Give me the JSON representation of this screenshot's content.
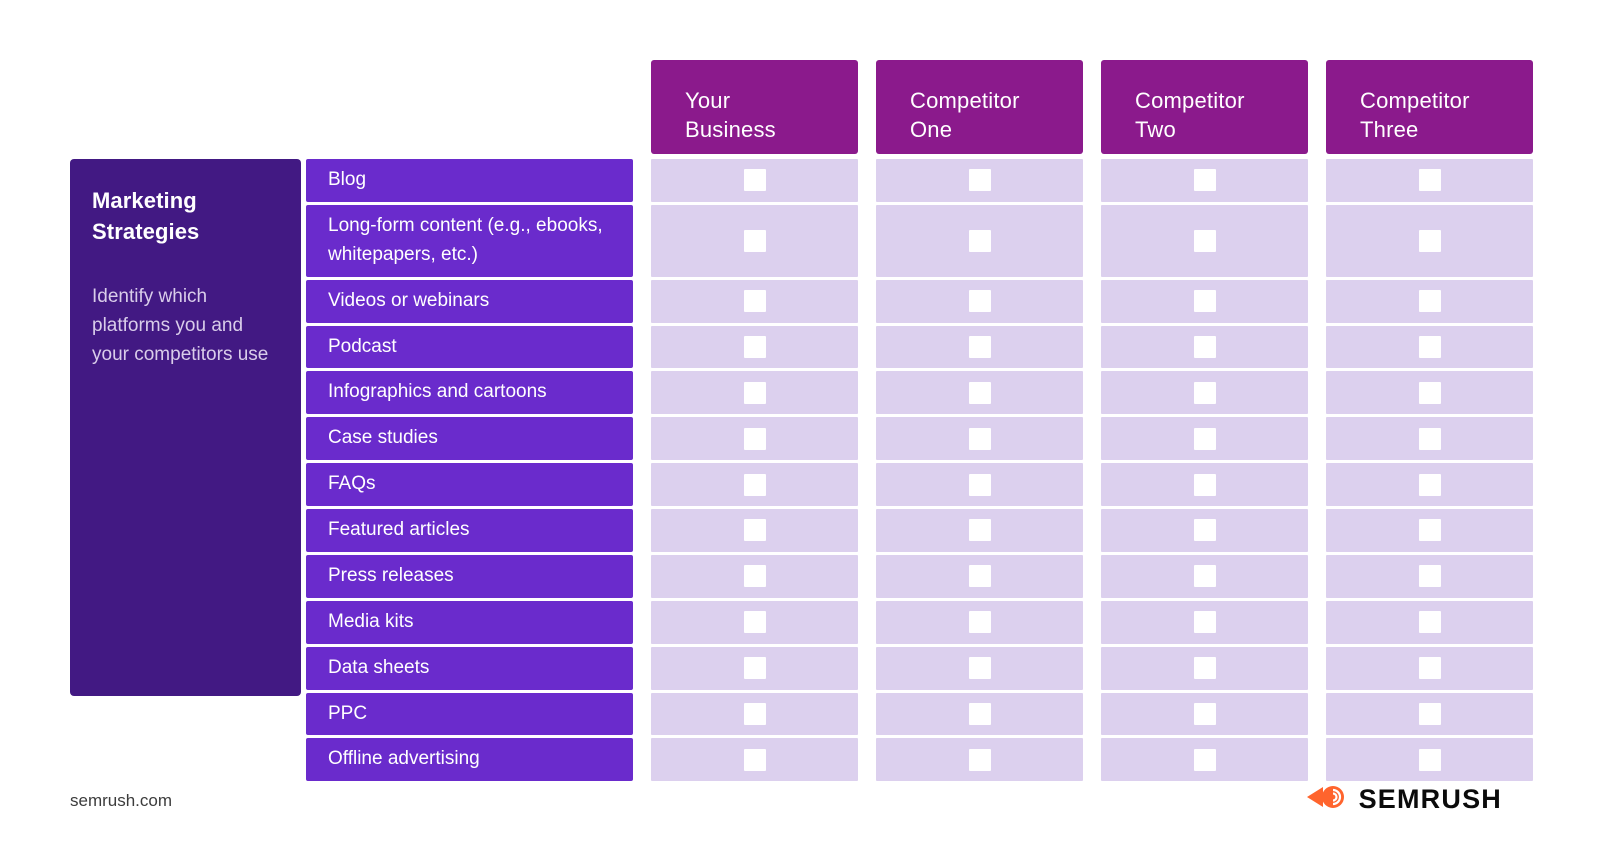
{
  "sidebar": {
    "title": "Marketing\nStrategies",
    "title_line1": "Marketing",
    "title_line2": "Strategies",
    "description": "Identify which platforms you and your competitors use",
    "bg_color": "#421983"
  },
  "table": {
    "header_bg": "#8B1A8C",
    "row_label_bg": "#6A2BCC",
    "cell_bg": "#DCD0EE",
    "checkbox_color": "#FFFFFF",
    "columns": [
      {
        "label_line1": "Your",
        "label_line2": "Business",
        "label": "Your Business"
      },
      {
        "label_line1": "Competitor",
        "label_line2": "One",
        "label": "Competitor One"
      },
      {
        "label_line1": "Competitor",
        "label_line2": "Two",
        "label": "Competitor Two"
      },
      {
        "label_line1": "Competitor",
        "label_line2": "Three",
        "label": "Competitor Three"
      }
    ],
    "rows": [
      {
        "label": "Blog",
        "checked": [
          false,
          false,
          false,
          false
        ]
      },
      {
        "label": "Long-form content (e.g., ebooks, whitepapers, etc.)",
        "checked": [
          false,
          false,
          false,
          false
        ]
      },
      {
        "label": "Videos or webinars",
        "checked": [
          false,
          false,
          false,
          false
        ]
      },
      {
        "label": "Podcast",
        "checked": [
          false,
          false,
          false,
          false
        ]
      },
      {
        "label": "Infographics and cartoons",
        "checked": [
          false,
          false,
          false,
          false
        ]
      },
      {
        "label": "Case studies",
        "checked": [
          false,
          false,
          false,
          false
        ]
      },
      {
        "label": "FAQs",
        "checked": [
          false,
          false,
          false,
          false
        ]
      },
      {
        "label": "Featured articles",
        "checked": [
          false,
          false,
          false,
          false
        ]
      },
      {
        "label": "Press releases",
        "checked": [
          false,
          false,
          false,
          false
        ]
      },
      {
        "label": "Media kits",
        "checked": [
          false,
          false,
          false,
          false
        ]
      },
      {
        "label": "Data sheets",
        "checked": [
          false,
          false,
          false,
          false
        ]
      },
      {
        "label": "PPC",
        "checked": [
          false,
          false,
          false,
          false
        ]
      },
      {
        "label": "Offline advertising",
        "checked": [
          false,
          false,
          false,
          false
        ]
      }
    ]
  },
  "footer": {
    "url": "semrush.com",
    "brand_name": "SEMRUSH",
    "brand_icon": "semrush-comet-icon",
    "brand_color": "#FF642D"
  }
}
